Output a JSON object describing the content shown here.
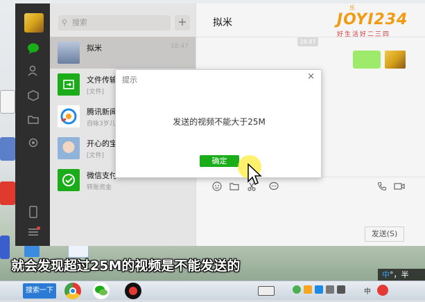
{
  "wechat": {
    "search_placeholder": "搜索",
    "plus": "+",
    "chats": [
      {
        "name": "拟米",
        "preview": "",
        "time": "18:47",
        "selected": true,
        "color": "#6a7fa0"
      },
      {
        "name": "文件传输",
        "preview": "[文件]",
        "time": "",
        "selected": false,
        "color": "#1aad19"
      },
      {
        "name": "腾讯新闻",
        "preview": "自咏3岁儿",
        "time": "",
        "selected": false,
        "color": "#ffffff"
      },
      {
        "name": "开心的宝",
        "preview": "[文件]",
        "time": "",
        "selected": false,
        "color": "#8fb3d9"
      },
      {
        "name": "微信支付",
        "preview": "转账资金",
        "time": "",
        "selected": false,
        "color": "#1aad19"
      }
    ],
    "chat_title": "拟米",
    "timestamp": "18:47",
    "send_label": "发送(S)"
  },
  "dialog": {
    "title": "提示",
    "close": "×",
    "message": "发送的视频不能大于25M",
    "ok_label": "确定"
  },
  "subtitle": "就会发现超过25M的视频是不能发送的",
  "logo": {
    "text": "JOYI234",
    "top": "乐",
    "slogan": "好生活好二三四"
  },
  "taskbar": {
    "start_label": "搜索一下",
    "tray_lang": "中",
    "ime_main": "中",
    "ime_extra": "°，半"
  },
  "colors": {
    "wechat_green": "#1aad19",
    "nav_dark": "#2e2e2e",
    "bubble_green": "#9eea6a"
  }
}
